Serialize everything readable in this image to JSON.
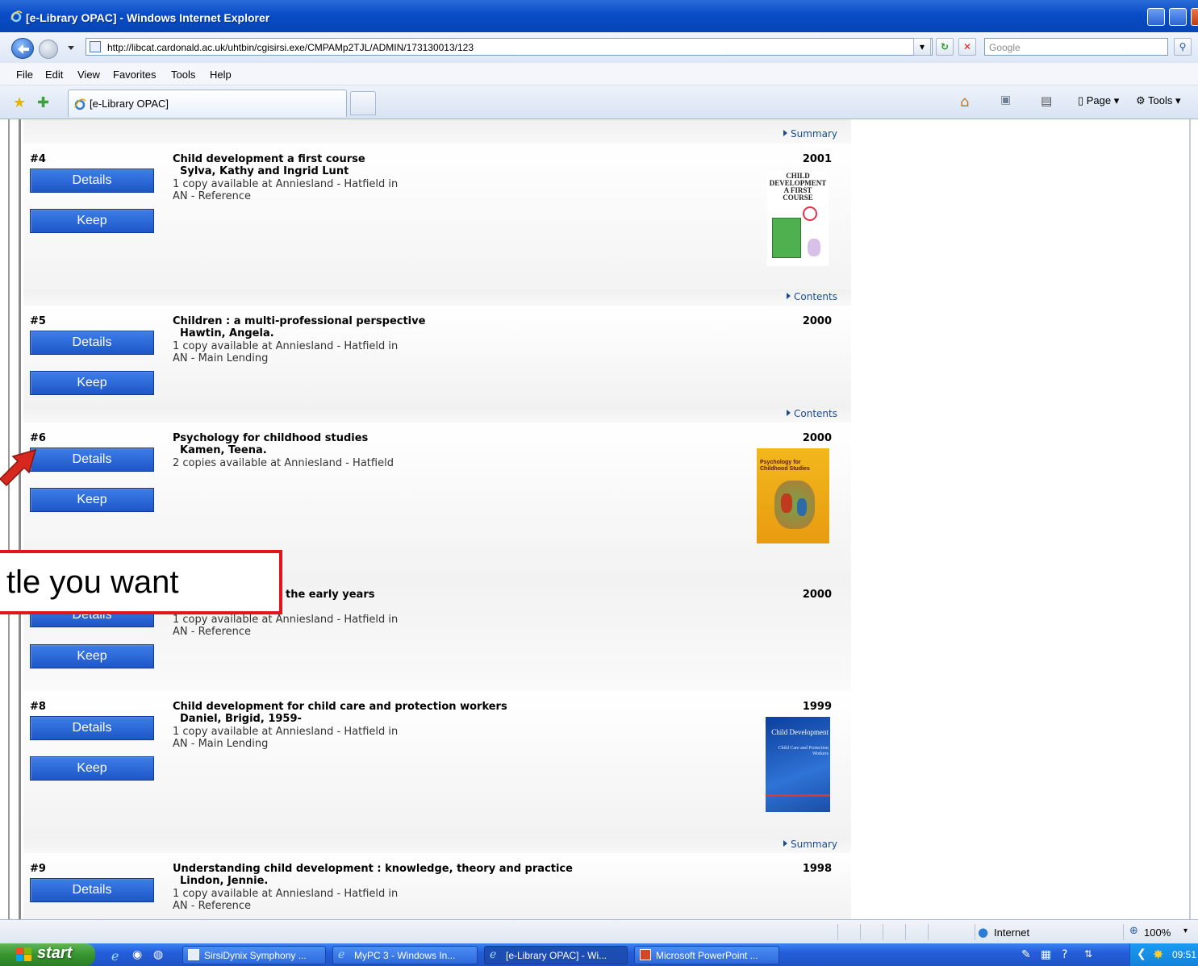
{
  "window": {
    "title": "[e-Library OPAC] - Windows Internet Explorer",
    "url": "http://libcat.cardonald.ac.uk/uhtbin/cgisirsi.exe/CMPAMp2TJL/ADMIN/173130013/123",
    "search_placeholder": "Google"
  },
  "menu": [
    "File",
    "Edit",
    "View",
    "Favorites",
    "Tools",
    "Help"
  ],
  "tab": {
    "label": "[e-Library OPAC]"
  },
  "commandbar": {
    "page": "Page",
    "tools": "Tools"
  },
  "results": {
    "top_link": "Summary",
    "records": [
      {
        "num": "#4",
        "title": "Child development a first course",
        "author": "Sylva, Kathy and Ingrid Lunt",
        "avail1": "1 copy available at Anniesland - Hatfield in",
        "avail2": "AN - Reference",
        "year": "2001",
        "details": "Details",
        "keep": "Keep",
        "bottom_link": "Contents"
      },
      {
        "num": "#5",
        "title": "Children : a multi-professional perspective",
        "author": "Hawtin, Angela.",
        "avail1": "1 copy available at Anniesland - Hatfield in",
        "avail2": "AN - Main Lending",
        "year": "2000",
        "details": "Details",
        "keep": "Keep",
        "bottom_link": "Contents"
      },
      {
        "num": "#6",
        "title": "Psychology for childhood studies",
        "author": "Kamen, Teena.",
        "avail1": "2 copies available at Anniesland - Hatfield",
        "avail2": "",
        "year": "2000",
        "details": "Details",
        "keep": "Keep"
      },
      {
        "num": "",
        "title": "the early years",
        "author": "",
        "avail1": "1 copy available at Anniesland - Hatfield in",
        "avail2": "AN - Reference",
        "year": "2000",
        "details": "Details",
        "keep": "Keep"
      },
      {
        "num": "#8",
        "title": "Child development for child care and protection workers",
        "author": "Daniel, Brigid, 1959-",
        "avail1": "1 copy available at Anniesland - Hatfield in",
        "avail2": "AN - Main Lending",
        "year": "1999",
        "details": "Details",
        "keep": "Keep",
        "bottom_link": "Summary"
      },
      {
        "num": "#9",
        "title": "Understanding child development : knowledge, theory and practice",
        "author": "Lindon, Jennie.",
        "avail1": "1 copy available at Anniesland - Hatfield in",
        "avail2": "AN - Reference",
        "year": "1998",
        "details": "Details"
      }
    ],
    "covers": {
      "c1": {
        "line1": "CHILD",
        "line2": "DEVELOPMENT",
        "line3": "A FIRST COURSE"
      },
      "c2": {
        "line1": "Psychology for",
        "line2": "Childhood Studies"
      },
      "c3": {
        "line1": "Child Development",
        "line2": "Child Care and Protection Workers"
      }
    }
  },
  "callout": {
    "text": "tle you want"
  },
  "status": {
    "zone": "Internet",
    "zoom": "100%"
  },
  "taskbar": {
    "start": "start",
    "tasks": [
      "SirsiDynix Symphony ...",
      "MyPC 3 - Windows In...",
      "[e-Library OPAC] - Wi...",
      "Microsoft PowerPoint ..."
    ],
    "clock": "09:51"
  },
  "colors": {
    "accent": "#1e56c8",
    "callout": "#e3151a",
    "link": "#174c8e"
  }
}
